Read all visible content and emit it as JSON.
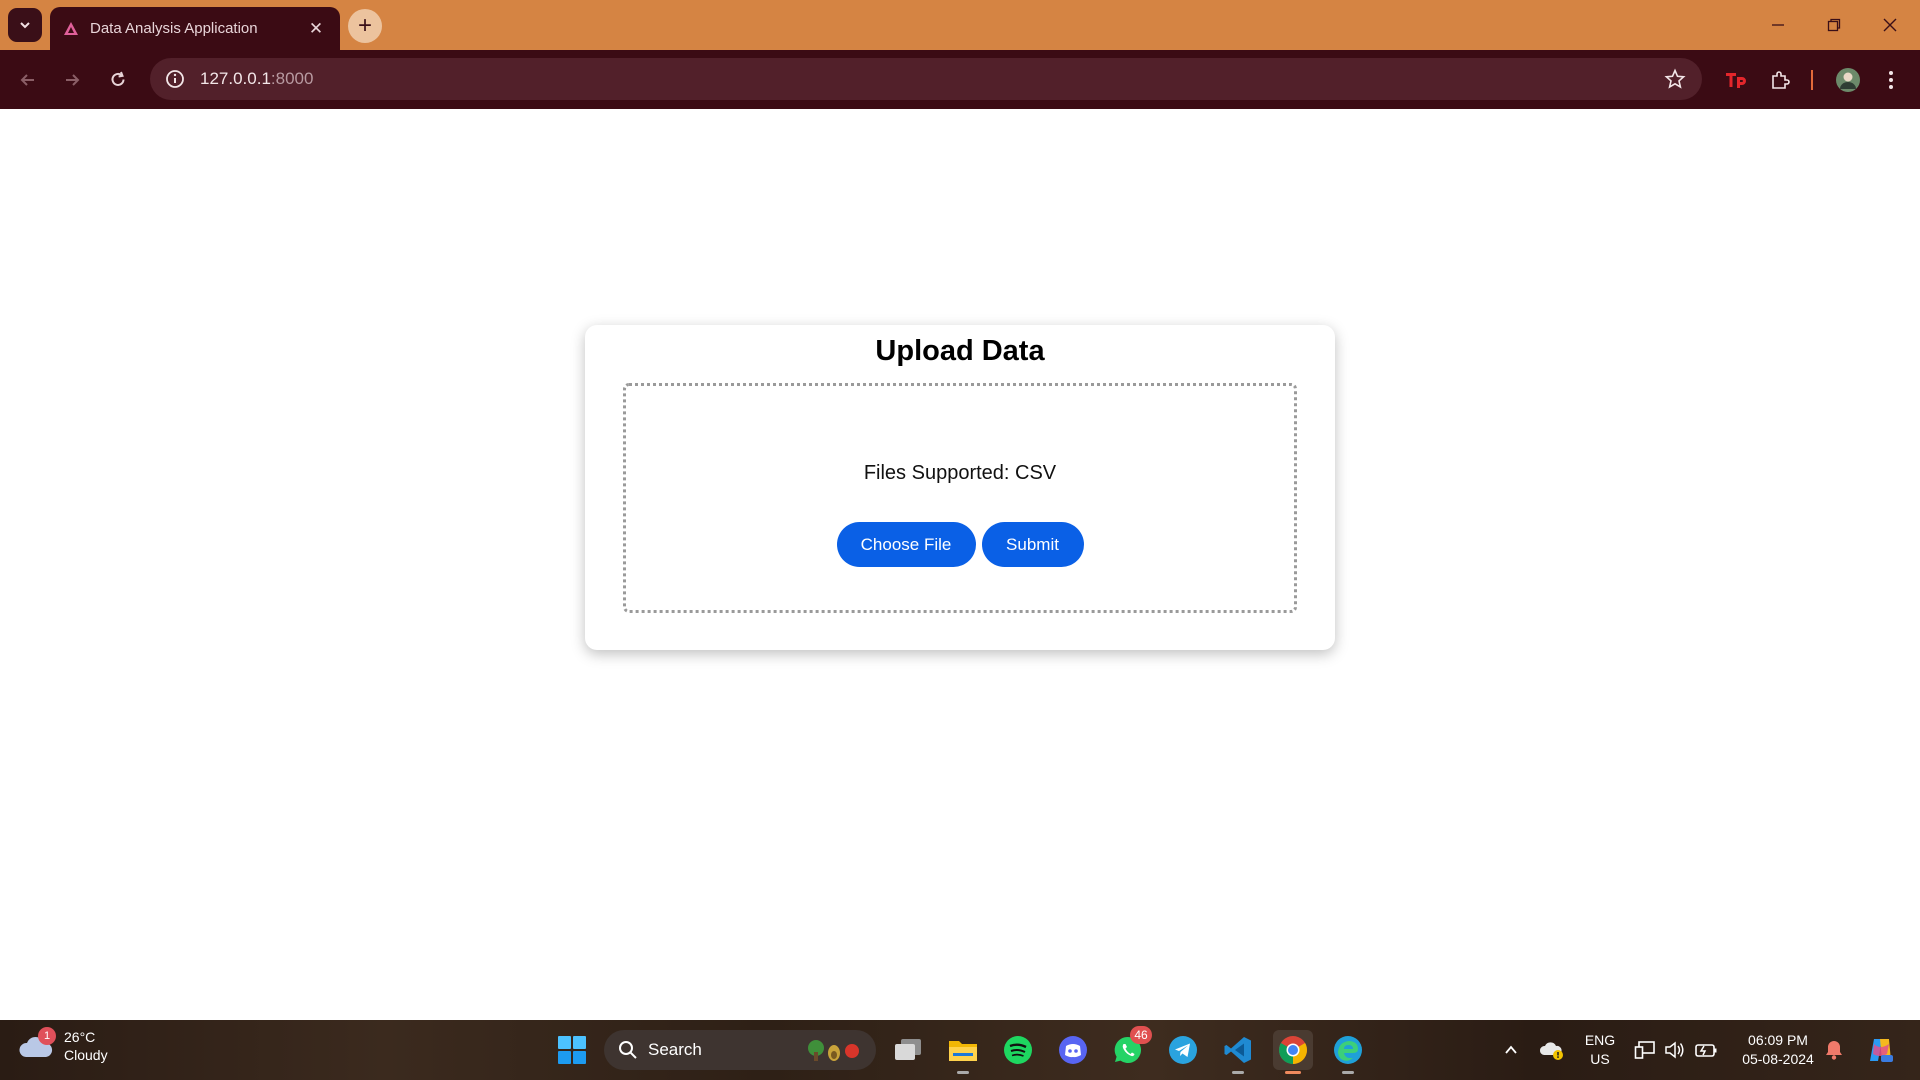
{
  "browser": {
    "tab_title": "Data Analysis Application",
    "url_host": "127.0.0.1",
    "url_port": ":8000"
  },
  "page": {
    "heading": "Upload Data",
    "supported_text": "Files Supported: CSV",
    "choose_label": "Choose File",
    "submit_label": "Submit"
  },
  "taskbar": {
    "weather_temp": "26°C",
    "weather_desc": "Cloudy",
    "weather_badge": "1",
    "search_label": "Search",
    "whatsapp_badge": "46",
    "lang_line1": "ENG",
    "lang_line2": "US",
    "time": "06:09 PM",
    "date": "05-08-2024"
  },
  "colors": {
    "tabstrip": "#d58443",
    "toolbar": "#3b0b14",
    "button": "#0a60e6"
  }
}
